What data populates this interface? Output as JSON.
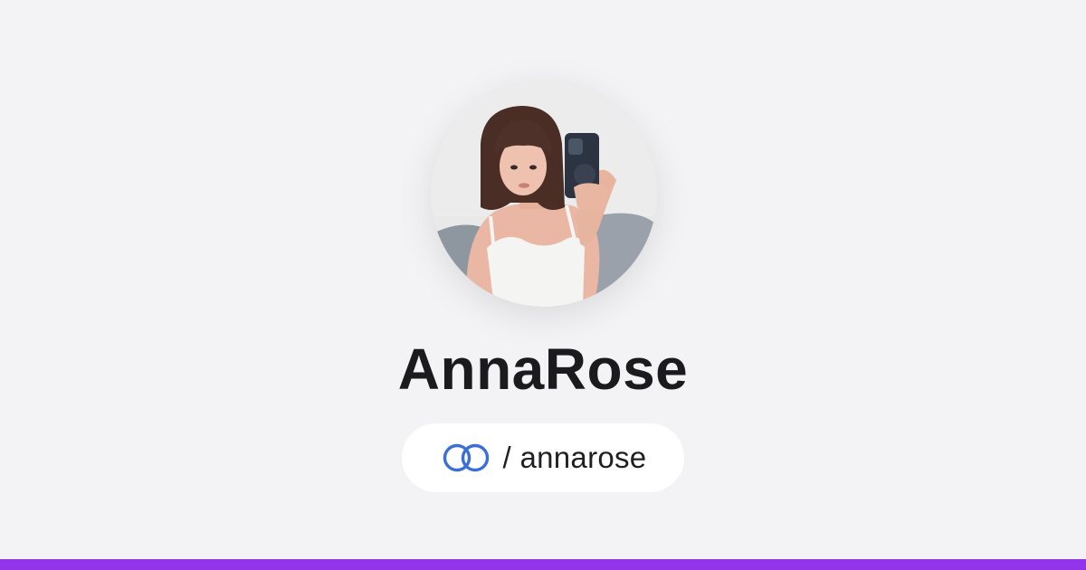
{
  "profile": {
    "display_name": "AnnaRose",
    "handle": "/ annarose",
    "avatar_image": "profile-photo"
  },
  "icons": {
    "link": "chain-link-icon"
  },
  "colors": {
    "background": "#f3f3f6",
    "accent_bar": "#9333ea",
    "link_icon": "#3b6fd8",
    "pill_background": "#ffffff",
    "text": "#1b1b1f"
  }
}
